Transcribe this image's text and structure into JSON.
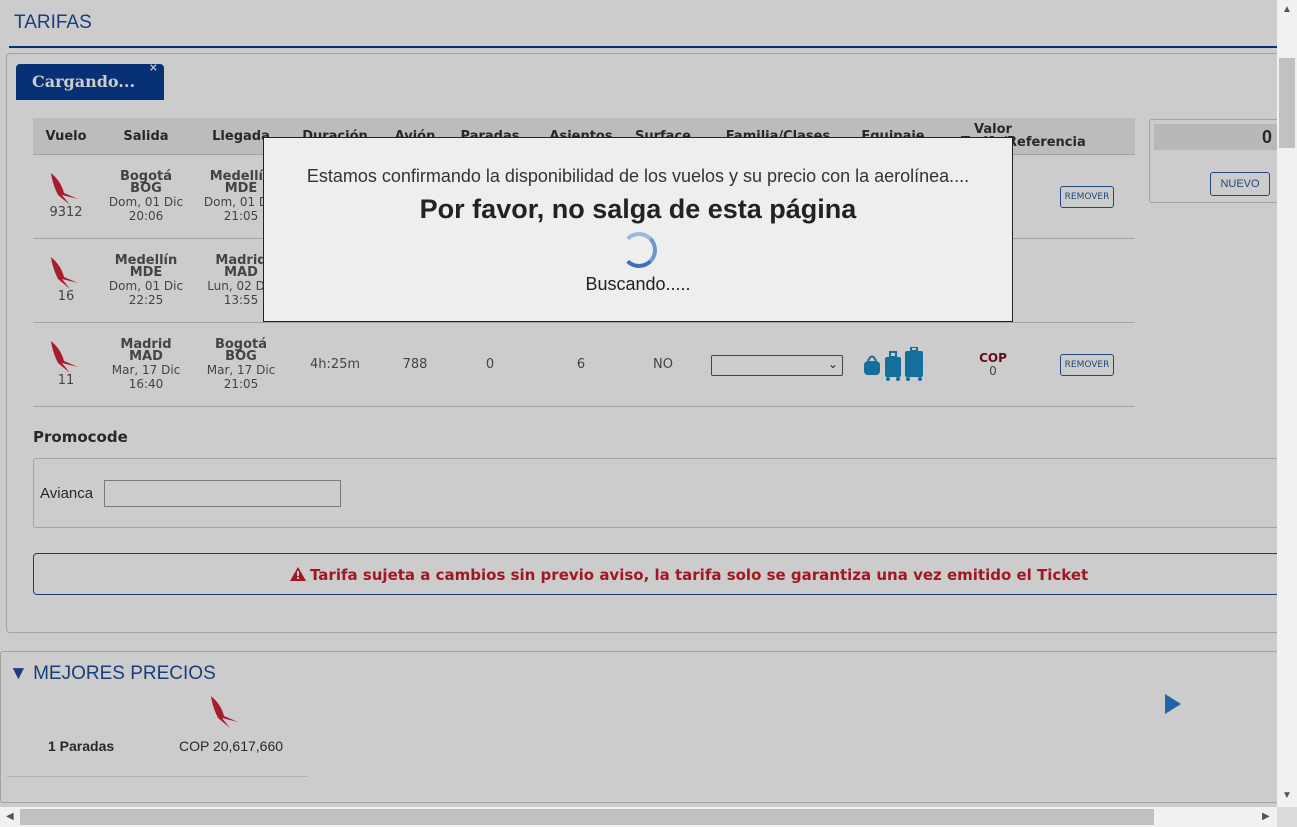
{
  "page_title": "TARIFAS",
  "tab": {
    "label": "Cargando...",
    "close": "×"
  },
  "table": {
    "headers": [
      "Vuelo",
      "Salida",
      "Llegada",
      "Duración",
      "Avión",
      "Paradas",
      "Asientos",
      "Surface",
      "Familia/Clases",
      "Equipaje",
      "Valor",
      "Tarifa/Referencia"
    ],
    "rows": [
      {
        "flight": "9312",
        "dep_city": "Bogotá",
        "dep_code": "BOG",
        "dep_date": "Dom, 01 Dic",
        "dep_time": "20:06",
        "arr_city": "Medellín",
        "arr_code": "MDE",
        "arr_date": "Dom, 01 Dic",
        "arr_time": "21:05",
        "remove": "REMOVER"
      },
      {
        "flight": "16",
        "dep_city": "Medellín",
        "dep_code": "MDE",
        "dep_date": "Dom, 01 Dic",
        "dep_time": "22:25",
        "arr_city": "Madrid",
        "arr_code": "MAD",
        "arr_date": "Lun, 02 Dic",
        "arr_time": "13:55"
      },
      {
        "flight": "11",
        "dep_city": "Madrid",
        "dep_code": "MAD",
        "dep_date": "Mar, 17 Dic",
        "dep_time": "16:40",
        "arr_city": "Bogotá",
        "arr_code": "BOG",
        "arr_date": "Mar, 17 Dic",
        "arr_time": "21:05",
        "duration": "4h:25m",
        "aircraft": "788",
        "stops": "0",
        "seats": "6",
        "surface": "NO",
        "currency": "COP",
        "amount": "0",
        "remove": "REMOVER"
      }
    ]
  },
  "sidebox": {
    "count": "0",
    "new_label": "NUEVO"
  },
  "promo": {
    "label": "Promocode",
    "airline": "Avianca",
    "value": ""
  },
  "warning": "Tarifa sujeta a cambios sin previo aviso, la tarifa solo se garantiza una vez emitido el Ticket",
  "best_prices": {
    "title": "MEJORES PRECIOS",
    "stops": "1 Paradas",
    "price": "COP 20,617,660"
  },
  "modal": {
    "message": "Estamos confirmando la disponibilidad de los vuelos y su precio con la aerolínea....",
    "title": "Por favor, no salga de esta página",
    "status": "Buscando....."
  },
  "colors": {
    "brand_blue": "#0b3d91",
    "link_blue": "#1f4e9c",
    "alert_red": "#c81e2e",
    "airline_red": "#d2233c",
    "luggage_blue": "#1a8bc4"
  },
  "icons": [
    "avianca-logo-icon",
    "warning-icon",
    "luggage-icon",
    "chevron-down-icon",
    "triangle-down-icon",
    "arrow-right-icon"
  ]
}
